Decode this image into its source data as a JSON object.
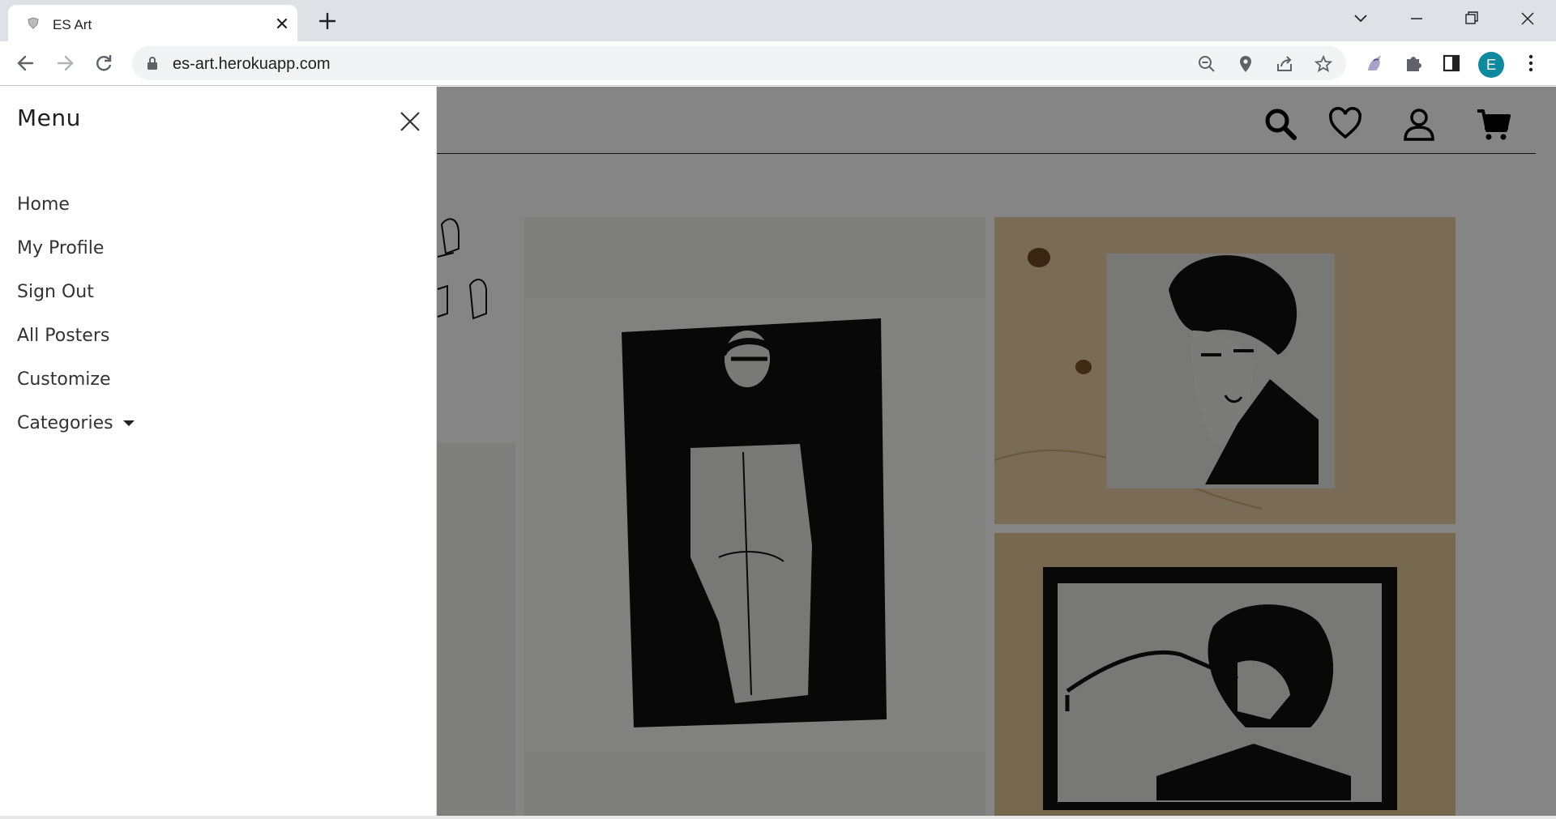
{
  "browser": {
    "tab_title": "ES Art",
    "url": "es-art.herokuapp.com",
    "profile_initial": "E"
  },
  "side_menu": {
    "title": "Menu",
    "items": [
      {
        "label": "Home"
      },
      {
        "label": "My Profile"
      },
      {
        "label": "Sign Out"
      },
      {
        "label": "All Posters"
      },
      {
        "label": "Customize"
      },
      {
        "label": "Categories"
      }
    ]
  },
  "header_icons": [
    "search-icon",
    "heart-icon",
    "user-icon",
    "cart-icon"
  ],
  "colors": {
    "overlay": "rgba(0,0,0,0.48)",
    "profile_avatar": "#0e8a9e",
    "tabstrip": "#dee1e6"
  }
}
